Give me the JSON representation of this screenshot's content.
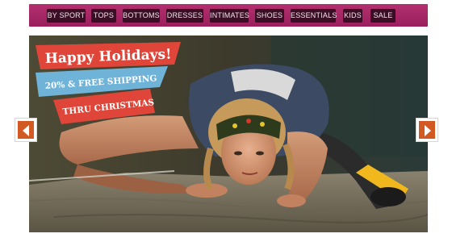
{
  "nav": {
    "items": [
      {
        "label": "BY SPORT"
      },
      {
        "label": "TOPS"
      },
      {
        "label": "BOTTOMS"
      },
      {
        "label": "DRESSES"
      },
      {
        "label": "INTIMATES"
      },
      {
        "label": "SHOES"
      },
      {
        "label": "ESSENTIALS"
      },
      {
        "label": "KIDS"
      },
      {
        "label": "SALE"
      }
    ]
  },
  "promo": {
    "line1": "Happy Holidays!",
    "line2": "20% & FREE SHIPPING",
    "line3": "THRU CHRISTMAS"
  },
  "carousel": {
    "prev_icon": "chevron-left-icon",
    "next_icon": "chevron-right-icon"
  },
  "colors": {
    "nav_bg": "#a3256a",
    "nav_item_bg": "#3a0f25",
    "promo_red": "#e0453a",
    "promo_blue": "#6fb3d8",
    "arrow_orange": "#d25a22"
  }
}
